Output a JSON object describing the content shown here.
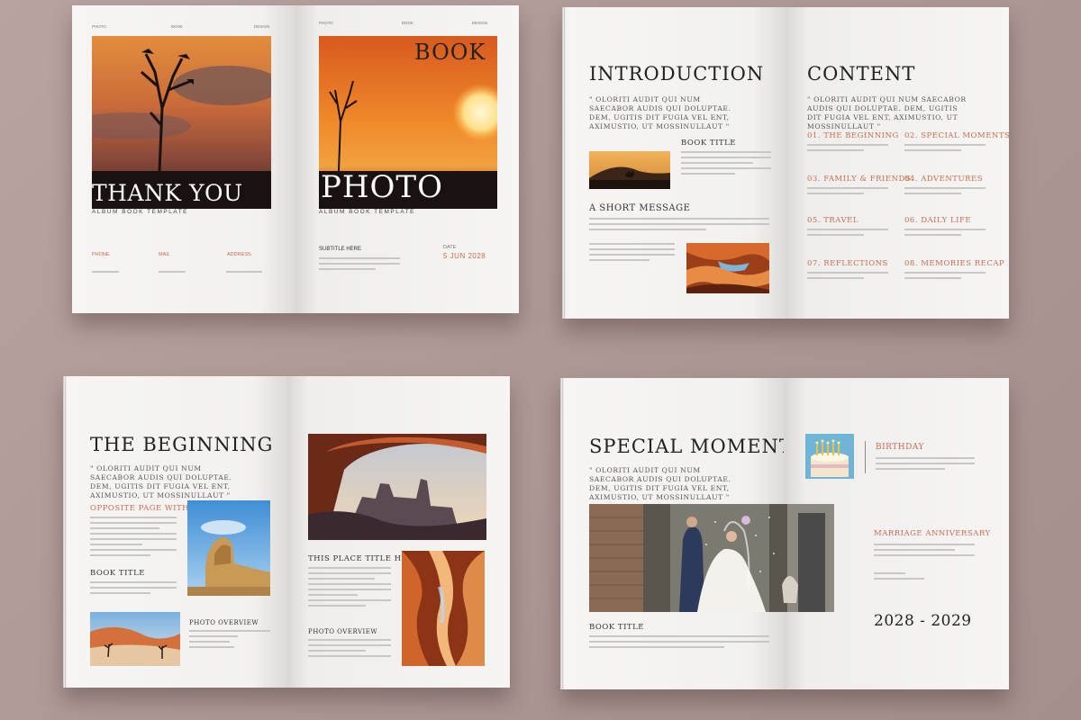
{
  "cover": {
    "tl_labels": [
      "PHOTO",
      "BOOK",
      "DESIGN"
    ],
    "tr_labels": [
      "PHOTO",
      "BOOK",
      "DESIGN"
    ],
    "thank_you": "THANK YOU",
    "album_left": "ALBUM BOOK TEMPLATE",
    "book_word": "BOOK",
    "photo_word": "PHOTO",
    "album_right": "ALBUM BOOK TEMPLATE",
    "phone_label": "PHONE",
    "mail_label": "MAIL",
    "address_label": "ADDRESS",
    "subtitle": "SUBTITLE HERE",
    "date_label": "DATE",
    "date_value": "5 JUN 2028"
  },
  "intro": {
    "title": "INTRODUCTION",
    "quote": "\" OLORITI AUDIT QUI NUM SAECABOR AUDIS QUI DOLUPTAE. DEM, UGITIS DIT FUGIA VEL ENT, AXIMUSTIO, UT MOSSINULLAUT \"",
    "book_title": "BOOK TITLE",
    "short_message": "A SHORT MESSAGE"
  },
  "content": {
    "title": "CONTENT",
    "quote": "\" OLORITI AUDIT QUI NUM SAECABOR AUDIS QUI DOLUPTAE. DEM, UGITIS DIT FUGIA VEL ENT, AXIMUSTIO, UT MOSSINULLAUT \"",
    "items": [
      "01. THE BEGINNING",
      "02. SPECIAL MOMENTS",
      "03. FAMILY & FRIENDS",
      "04. ADVENTURES",
      "05. TRAVEL",
      "06. DAILY LIFE",
      "07. REFLECTIONS",
      "08. MEMORIES RECAP"
    ]
  },
  "beginning": {
    "title": "THE BEGINNING",
    "quote": "\" OLORITI AUDIT QUI NUM SAECABOR AUDIS QUI DOLUPTAE. DEM, UGITIS DIT FUGIA VEL ENT, AXIMUSTIO, UT MOSSINULLAUT \"",
    "opposite": "OPPOSITE PAGE WITH CAPTION",
    "book_title": "BOOK TITLE",
    "photo_overview": "PHOTO OVERVIEW",
    "place_title": "THIS PLACE TITLE HERE",
    "photo_overview_2": "PHOTO OVERVIEW"
  },
  "special": {
    "title": "SPECIAL MOMENTS",
    "quote": "\" OLORITI AUDIT QUI NUM SAECABOR AUDIS QUI DOLUPTAE. DEM, UGITIS DIT FUGIA VEL ENT, AXIMUSTIO, UT MOSSINULLAUT \"",
    "birthday": "BIRTHDAY",
    "anniversary": "MARRIAGE ANNIVERSARY",
    "book_title": "BOOK TITLE",
    "years": "2028 - 2029"
  },
  "colors": {
    "accent": "#c96c4f",
    "background": "#ae9894",
    "paper": "#f4f3f1"
  }
}
